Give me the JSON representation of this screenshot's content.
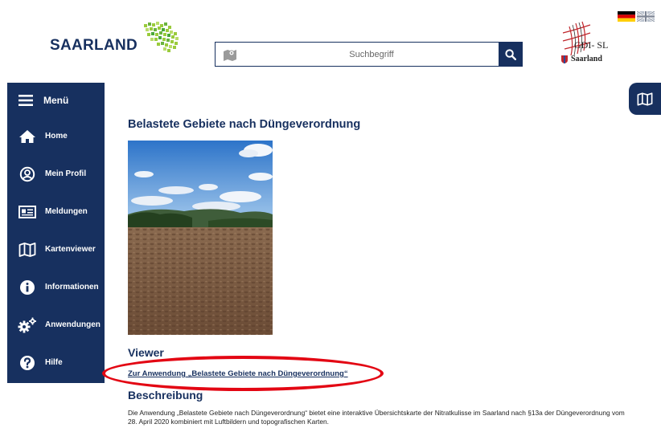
{
  "header": {
    "logo_text": "SAARLAND",
    "search_placeholder": "Suchbegriff",
    "gdi_title": "GDI- SL",
    "gdi_subtitle": "Saarland",
    "languages": [
      "de",
      "en"
    ]
  },
  "sidebar": {
    "menu_label": "Menü",
    "items": [
      {
        "label": "Home",
        "icon": "home-icon"
      },
      {
        "label": "Mein Profil",
        "icon": "profile-icon"
      },
      {
        "label": "Meldungen",
        "icon": "messages-icon"
      },
      {
        "label": "Kartenviewer",
        "icon": "map-icon"
      },
      {
        "label": "Informationen",
        "icon": "info-icon"
      },
      {
        "label": "Anwendungen",
        "icon": "gears-icon"
      },
      {
        "label": "Hilfe",
        "icon": "help-icon"
      }
    ]
  },
  "main": {
    "title": "Belastete Gebiete nach Düngeverordnung",
    "viewer_heading": "Viewer",
    "app_link": "Zur Anwendung „Belastete Gebiete nach Düngeverordnung“",
    "description_heading": "Beschreibung",
    "description_text": "Die Anwendung „Belastete Gebiete nach Düngeverordnung“ bietet eine interaktive Übersichtskarte der Nitratkulisse im Saarland nach §13a der Düngeverordnung vom 28. April 2020 kombiniert mit Luftbildern und topografischen Karten."
  },
  "colors": {
    "brand_navy": "#17305f",
    "highlight_red": "#e30613"
  }
}
